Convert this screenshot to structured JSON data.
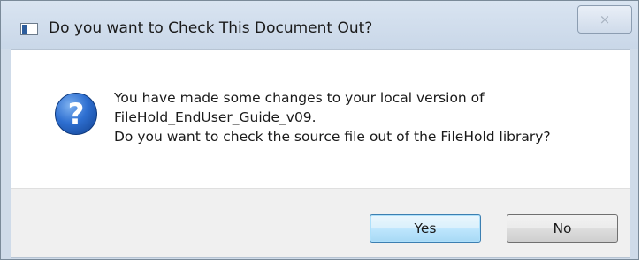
{
  "window": {
    "title": "Do you want to Check This Document Out?",
    "close_label": "⨯"
  },
  "message": {
    "line1": "You have made some changes to your local version of",
    "line2": "FileHold_EndUser_Guide_v09.",
    "line3": "Do you want to check the source file out of the FileHold library?"
  },
  "buttons": {
    "yes_label": "Yes",
    "no_label": "No"
  },
  "icons": {
    "app": "app-window-icon",
    "question": "question-icon",
    "question_glyph": "?"
  },
  "colors": {
    "titlebar": "#cfdbe9",
    "icon_blue": "#2e6fd1",
    "default_button_border": "#3c7fb1"
  }
}
